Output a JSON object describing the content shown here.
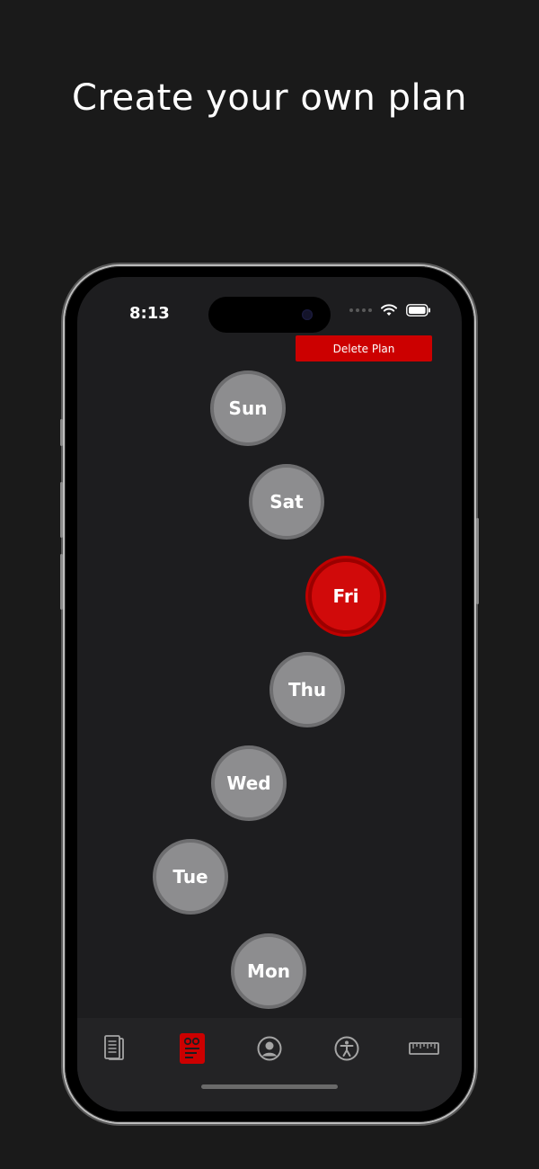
{
  "headline": "Create your own plan",
  "status_bar": {
    "time": "8:13"
  },
  "delete_plan_label": "Delete Plan",
  "days": [
    {
      "label": "Sun",
      "active": false
    },
    {
      "label": "Sat",
      "active": false
    },
    {
      "label": "Fri",
      "active": true
    },
    {
      "label": "Thu",
      "active": false
    },
    {
      "label": "Wed",
      "active": false
    },
    {
      "label": "Tue",
      "active": false
    },
    {
      "label": "Mon",
      "active": false
    }
  ],
  "tab_bar": {
    "items": [
      {
        "icon": "document-icon",
        "selected": false
      },
      {
        "icon": "planner-icon",
        "selected": true
      },
      {
        "icon": "profile-icon",
        "selected": false
      },
      {
        "icon": "accessibility-icon",
        "selected": false
      },
      {
        "icon": "ruler-icon",
        "selected": false
      }
    ]
  },
  "colors": {
    "accent": "#cc0000",
    "background": "#1a1a1a",
    "screen": "#1d1d1f",
    "day_inactive": "#8d8d8f"
  }
}
